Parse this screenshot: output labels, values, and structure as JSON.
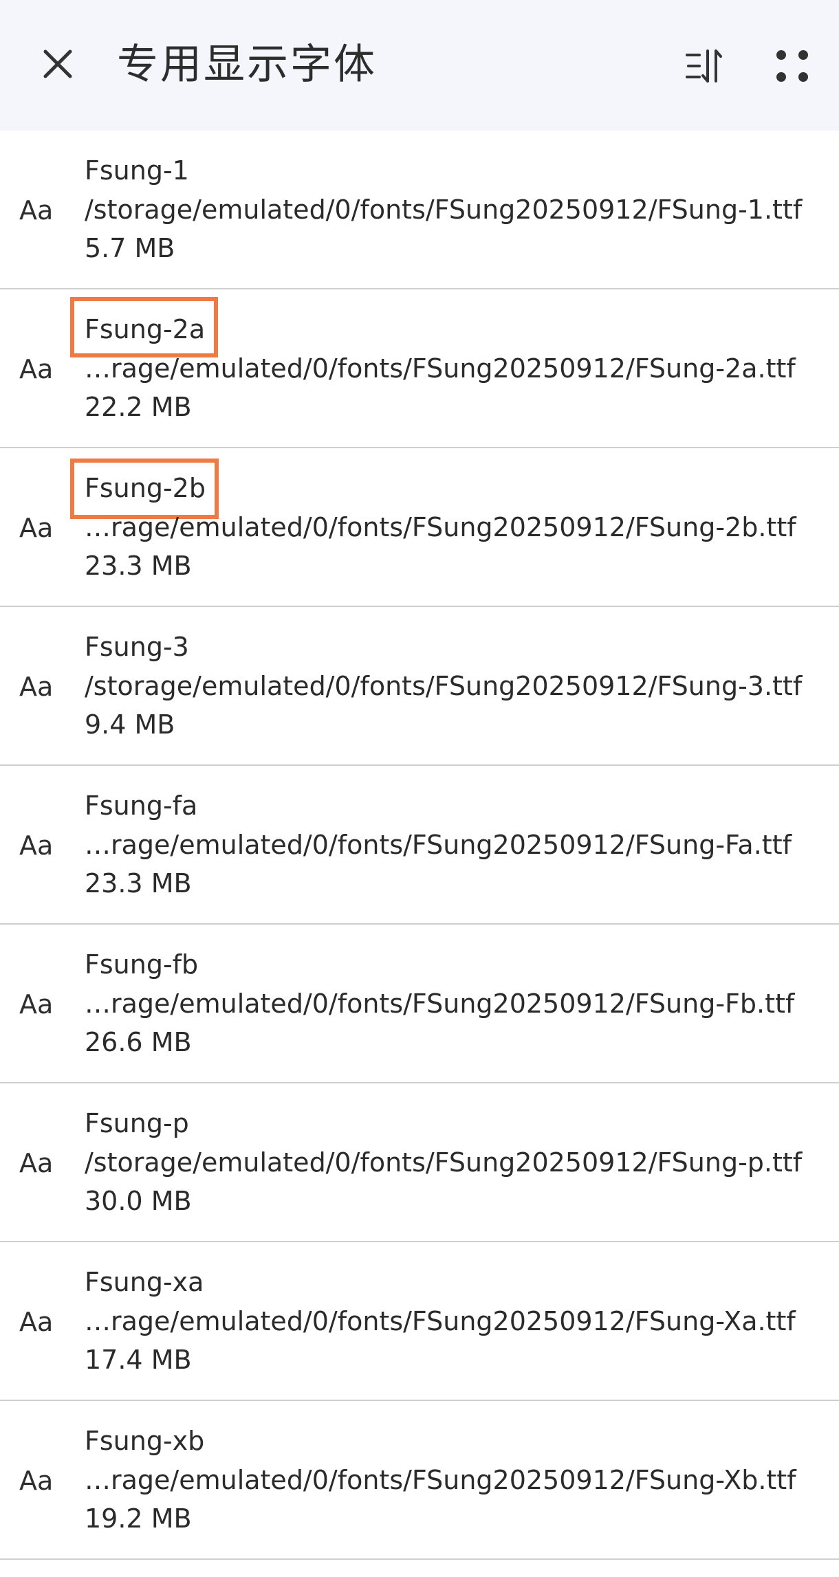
{
  "header": {
    "title": "专用显示字体",
    "close_icon": "close-icon",
    "sort_icon": "sort-icon",
    "more_icon": "more-dots-icon"
  },
  "colors": {
    "header_bg": "#f5f6fb",
    "highlight": "#f07a43",
    "divider": "#cfcfcf"
  },
  "fonts": [
    {
      "preview": "Aa",
      "name": "Fsung-1",
      "path": "/storage/emulated/0/fonts/FSung20250912/FSung-1.ttf",
      "size": "5.7 MB",
      "highlighted": false
    },
    {
      "preview": "Aa",
      "name": "Fsung-2a",
      "path": "…rage/emulated/0/fonts/FSung20250912/FSung-2a.ttf",
      "size": "22.2 MB",
      "highlighted": true
    },
    {
      "preview": "Aa",
      "name": "Fsung-2b",
      "path": "…rage/emulated/0/fonts/FSung20250912/FSung-2b.ttf",
      "size": "23.3 MB",
      "highlighted": true
    },
    {
      "preview": "Aa",
      "name": "Fsung-3",
      "path": "/storage/emulated/0/fonts/FSung20250912/FSung-3.ttf",
      "size": "9.4 MB",
      "highlighted": false
    },
    {
      "preview": "Aa",
      "name": "Fsung-fa",
      "path": "…rage/emulated/0/fonts/FSung20250912/FSung-Fa.ttf",
      "size": "23.3 MB",
      "highlighted": false
    },
    {
      "preview": "Aa",
      "name": "Fsung-fb",
      "path": "…rage/emulated/0/fonts/FSung20250912/FSung-Fb.ttf",
      "size": "26.6 MB",
      "highlighted": false
    },
    {
      "preview": "Aa",
      "name": "Fsung-p",
      "path": "/storage/emulated/0/fonts/FSung20250912/FSung-p.ttf",
      "size": "30.0 MB",
      "highlighted": false
    },
    {
      "preview": "Aa",
      "name": "Fsung-xa",
      "path": "…rage/emulated/0/fonts/FSung20250912/FSung-Xa.ttf",
      "size": "17.4 MB",
      "highlighted": false
    },
    {
      "preview": "Aa",
      "name": "Fsung-xb",
      "path": "…rage/emulated/0/fonts/FSung20250912/FSung-Xb.ttf",
      "size": "19.2 MB",
      "highlighted": false
    }
  ]
}
